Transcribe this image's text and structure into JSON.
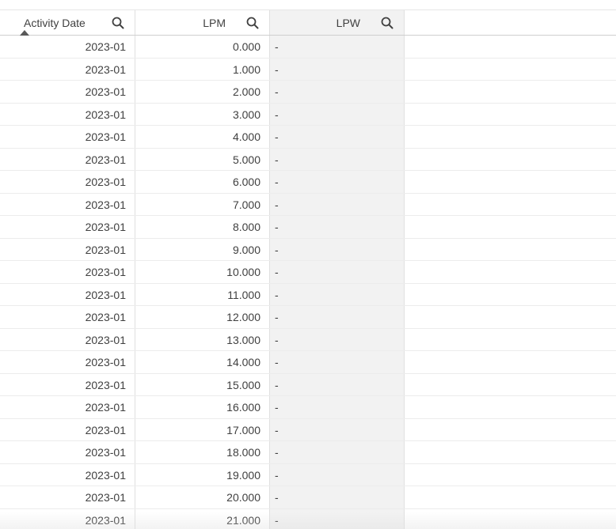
{
  "table": {
    "columns": [
      {
        "label": "Activity Date",
        "sort": "ascending",
        "search_icon": "search-icon"
      },
      {
        "label": "LPM",
        "search_icon": "search-icon"
      },
      {
        "label": "LPW",
        "search_icon": "search-icon"
      }
    ],
    "rows": [
      {
        "date": "2023-01",
        "lpm": "0.000",
        "lpw": "-"
      },
      {
        "date": "2023-01",
        "lpm": "1.000",
        "lpw": "-"
      },
      {
        "date": "2023-01",
        "lpm": "2.000",
        "lpw": "-"
      },
      {
        "date": "2023-01",
        "lpm": "3.000",
        "lpw": "-"
      },
      {
        "date": "2023-01",
        "lpm": "4.000",
        "lpw": "-"
      },
      {
        "date": "2023-01",
        "lpm": "5.000",
        "lpw": "-"
      },
      {
        "date": "2023-01",
        "lpm": "6.000",
        "lpw": "-"
      },
      {
        "date": "2023-01",
        "lpm": "7.000",
        "lpw": "-"
      },
      {
        "date": "2023-01",
        "lpm": "8.000",
        "lpw": "-"
      },
      {
        "date": "2023-01",
        "lpm": "9.000",
        "lpw": "-"
      },
      {
        "date": "2023-01",
        "lpm": "10.000",
        "lpw": "-"
      },
      {
        "date": "2023-01",
        "lpm": "11.000",
        "lpw": "-"
      },
      {
        "date": "2023-01",
        "lpm": "12.000",
        "lpw": "-"
      },
      {
        "date": "2023-01",
        "lpm": "13.000",
        "lpw": "-"
      },
      {
        "date": "2023-01",
        "lpm": "14.000",
        "lpw": "-"
      },
      {
        "date": "2023-01",
        "lpm": "15.000",
        "lpw": "-"
      },
      {
        "date": "2023-01",
        "lpm": "16.000",
        "lpw": "-"
      },
      {
        "date": "2023-01",
        "lpm": "17.000",
        "lpw": "-"
      },
      {
        "date": "2023-01",
        "lpm": "18.000",
        "lpw": "-"
      },
      {
        "date": "2023-01",
        "lpm": "19.000",
        "lpw": "-"
      },
      {
        "date": "2023-01",
        "lpm": "20.000",
        "lpw": "-"
      },
      {
        "date": "2023-01",
        "lpm": "21.000",
        "lpw": "-"
      }
    ]
  }
}
